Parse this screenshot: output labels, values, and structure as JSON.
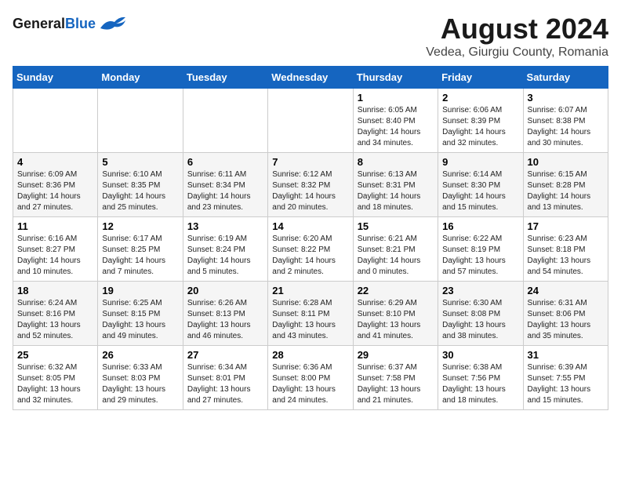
{
  "logo": {
    "general": "General",
    "blue": "Blue"
  },
  "title": "August 2024",
  "subtitle": "Vedea, Giurgiu County, Romania",
  "days_header": [
    "Sunday",
    "Monday",
    "Tuesday",
    "Wednesday",
    "Thursday",
    "Friday",
    "Saturday"
  ],
  "weeks": [
    [
      {
        "day": "",
        "info": ""
      },
      {
        "day": "",
        "info": ""
      },
      {
        "day": "",
        "info": ""
      },
      {
        "day": "",
        "info": ""
      },
      {
        "day": "1",
        "info": "Sunrise: 6:05 AM\nSunset: 8:40 PM\nDaylight: 14 hours and 34 minutes."
      },
      {
        "day": "2",
        "info": "Sunrise: 6:06 AM\nSunset: 8:39 PM\nDaylight: 14 hours and 32 minutes."
      },
      {
        "day": "3",
        "info": "Sunrise: 6:07 AM\nSunset: 8:38 PM\nDaylight: 14 hours and 30 minutes."
      }
    ],
    [
      {
        "day": "4",
        "info": "Sunrise: 6:09 AM\nSunset: 8:36 PM\nDaylight: 14 hours and 27 minutes."
      },
      {
        "day": "5",
        "info": "Sunrise: 6:10 AM\nSunset: 8:35 PM\nDaylight: 14 hours and 25 minutes."
      },
      {
        "day": "6",
        "info": "Sunrise: 6:11 AM\nSunset: 8:34 PM\nDaylight: 14 hours and 23 minutes."
      },
      {
        "day": "7",
        "info": "Sunrise: 6:12 AM\nSunset: 8:32 PM\nDaylight: 14 hours and 20 minutes."
      },
      {
        "day": "8",
        "info": "Sunrise: 6:13 AM\nSunset: 8:31 PM\nDaylight: 14 hours and 18 minutes."
      },
      {
        "day": "9",
        "info": "Sunrise: 6:14 AM\nSunset: 8:30 PM\nDaylight: 14 hours and 15 minutes."
      },
      {
        "day": "10",
        "info": "Sunrise: 6:15 AM\nSunset: 8:28 PM\nDaylight: 14 hours and 13 minutes."
      }
    ],
    [
      {
        "day": "11",
        "info": "Sunrise: 6:16 AM\nSunset: 8:27 PM\nDaylight: 14 hours and 10 minutes."
      },
      {
        "day": "12",
        "info": "Sunrise: 6:17 AM\nSunset: 8:25 PM\nDaylight: 14 hours and 7 minutes."
      },
      {
        "day": "13",
        "info": "Sunrise: 6:19 AM\nSunset: 8:24 PM\nDaylight: 14 hours and 5 minutes."
      },
      {
        "day": "14",
        "info": "Sunrise: 6:20 AM\nSunset: 8:22 PM\nDaylight: 14 hours and 2 minutes."
      },
      {
        "day": "15",
        "info": "Sunrise: 6:21 AM\nSunset: 8:21 PM\nDaylight: 14 hours and 0 minutes."
      },
      {
        "day": "16",
        "info": "Sunrise: 6:22 AM\nSunset: 8:19 PM\nDaylight: 13 hours and 57 minutes."
      },
      {
        "day": "17",
        "info": "Sunrise: 6:23 AM\nSunset: 8:18 PM\nDaylight: 13 hours and 54 minutes."
      }
    ],
    [
      {
        "day": "18",
        "info": "Sunrise: 6:24 AM\nSunset: 8:16 PM\nDaylight: 13 hours and 52 minutes."
      },
      {
        "day": "19",
        "info": "Sunrise: 6:25 AM\nSunset: 8:15 PM\nDaylight: 13 hours and 49 minutes."
      },
      {
        "day": "20",
        "info": "Sunrise: 6:26 AM\nSunset: 8:13 PM\nDaylight: 13 hours and 46 minutes."
      },
      {
        "day": "21",
        "info": "Sunrise: 6:28 AM\nSunset: 8:11 PM\nDaylight: 13 hours and 43 minutes."
      },
      {
        "day": "22",
        "info": "Sunrise: 6:29 AM\nSunset: 8:10 PM\nDaylight: 13 hours and 41 minutes."
      },
      {
        "day": "23",
        "info": "Sunrise: 6:30 AM\nSunset: 8:08 PM\nDaylight: 13 hours and 38 minutes."
      },
      {
        "day": "24",
        "info": "Sunrise: 6:31 AM\nSunset: 8:06 PM\nDaylight: 13 hours and 35 minutes."
      }
    ],
    [
      {
        "day": "25",
        "info": "Sunrise: 6:32 AM\nSunset: 8:05 PM\nDaylight: 13 hours and 32 minutes."
      },
      {
        "day": "26",
        "info": "Sunrise: 6:33 AM\nSunset: 8:03 PM\nDaylight: 13 hours and 29 minutes."
      },
      {
        "day": "27",
        "info": "Sunrise: 6:34 AM\nSunset: 8:01 PM\nDaylight: 13 hours and 27 minutes."
      },
      {
        "day": "28",
        "info": "Sunrise: 6:36 AM\nSunset: 8:00 PM\nDaylight: 13 hours and 24 minutes."
      },
      {
        "day": "29",
        "info": "Sunrise: 6:37 AM\nSunset: 7:58 PM\nDaylight: 13 hours and 21 minutes."
      },
      {
        "day": "30",
        "info": "Sunrise: 6:38 AM\nSunset: 7:56 PM\nDaylight: 13 hours and 18 minutes."
      },
      {
        "day": "31",
        "info": "Sunrise: 6:39 AM\nSunset: 7:55 PM\nDaylight: 13 hours and 15 minutes."
      }
    ]
  ]
}
